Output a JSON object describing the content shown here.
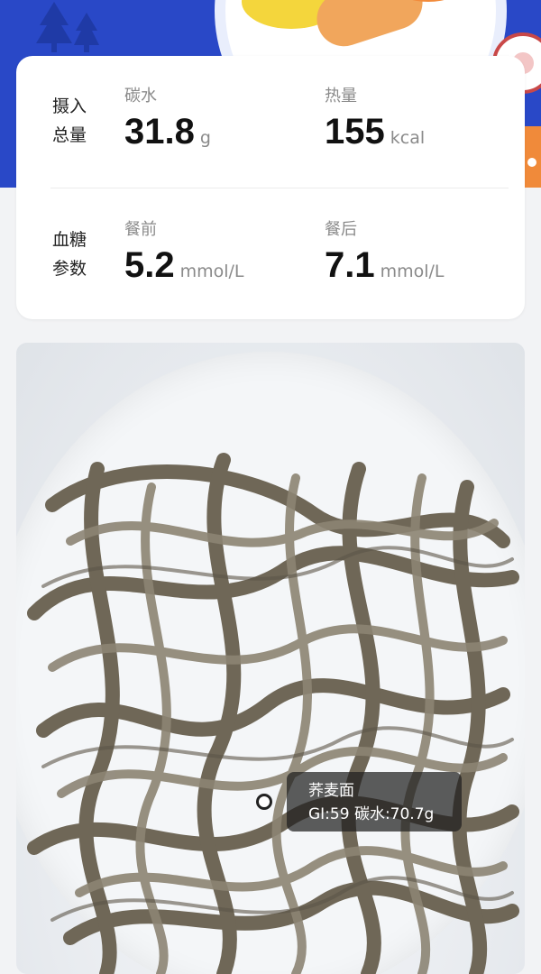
{
  "summary": {
    "intake": {
      "title_line1": "摄入",
      "title_line2": "总量",
      "carbs": {
        "label": "碳水",
        "value": "31.8",
        "unit": "g"
      },
      "calories": {
        "label": "热量",
        "value": "155",
        "unit": "kcal"
      }
    },
    "glucose": {
      "title_line1": "血糖",
      "title_line2": "参数",
      "before": {
        "label": "餐前",
        "value": "5.2",
        "unit": "mmol/L"
      },
      "after": {
        "label": "餐后",
        "value": "7.1",
        "unit": "mmol/L"
      }
    }
  },
  "photo": {
    "tag": {
      "name": "荞麦面",
      "info": "GI:59 碳水:70.7g"
    }
  },
  "colors": {
    "header_blue": "#2948c7",
    "card_bg": "#ffffff",
    "page_bg": "#f2f3f5",
    "noodle": "#7a7263"
  }
}
